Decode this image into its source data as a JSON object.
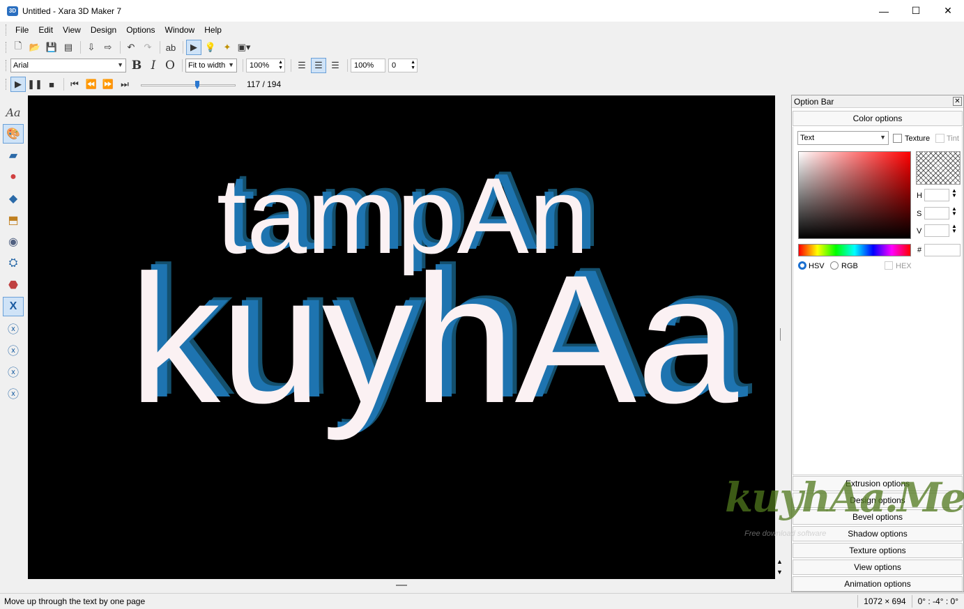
{
  "window": {
    "title": "Untitled - Xara 3D Maker 7",
    "minimize": "—",
    "maximize": "☐",
    "close": "✕"
  },
  "menu": [
    "File",
    "Edit",
    "View",
    "Design",
    "Options",
    "Window",
    "Help"
  ],
  "toolbar2": {
    "font": "Arial",
    "bold": "B",
    "italic": "I",
    "outline": "O",
    "fit": "Fit to width",
    "size_pct": "100%",
    "spacing_pct": "100%",
    "spacing_val": "0"
  },
  "playback": {
    "frame": "117 / 194"
  },
  "canvas": {
    "line1": "tampAn",
    "line2": "kuyhAa",
    "face_color": "#fbf1f3",
    "extrude_color": "#1e74b0",
    "bg": "#000000"
  },
  "option_bar": {
    "title": "Option Bar",
    "close": "✕",
    "color_options": "Color options",
    "target": "Text",
    "texture_label": "Texture",
    "tint_label": "Tint",
    "h_label": "H",
    "s_label": "S",
    "v_label": "V",
    "hash_label": "#",
    "hsv_label": "HSV",
    "rgb_label": "RGB",
    "hex_label": "HEX",
    "sections": [
      "Extrusion options",
      "Design options",
      "Bevel options",
      "Shadow options",
      "Texture options",
      "View options",
      "Animation options"
    ]
  },
  "status": {
    "message": "Move up through the text by one page",
    "size": "1072 × 694",
    "angle": "0° : -4° : 0°"
  },
  "watermark": {
    "brand": "kuyhAa.Me",
    "tagline": "Free download software"
  }
}
